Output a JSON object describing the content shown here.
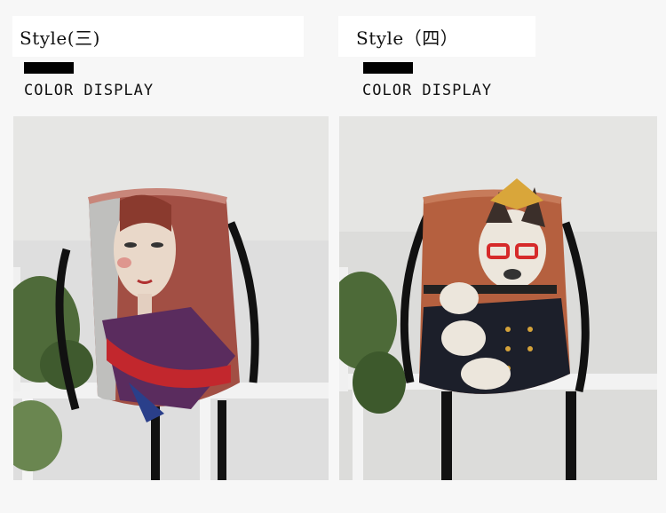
{
  "panels": [
    {
      "title": "Style(三)",
      "label": "COLOR DISPLAY",
      "image": {
        "subject": "drawstring-backpack-woman-portrait"
      }
    },
    {
      "title": "Style（四）",
      "label": "COLOR DISPLAY",
      "image": {
        "subject": "drawstring-backpack-dog-with-glasses"
      }
    }
  ],
  "colors": {
    "page_background": "#f7f7f7",
    "title_box": "#ffffff",
    "bar": "#000000",
    "text": "#111111"
  }
}
